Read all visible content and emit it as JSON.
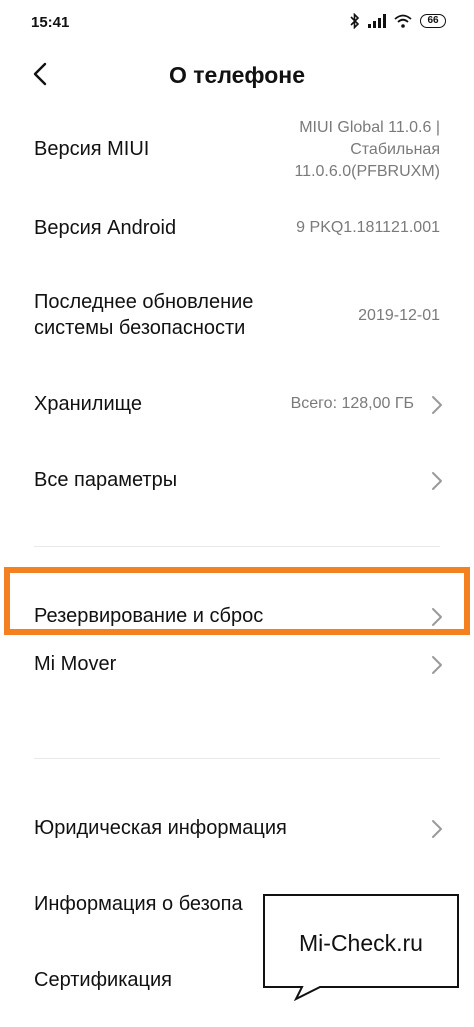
{
  "status_bar": {
    "time": "15:41",
    "battery": "66",
    "icons": [
      "bluetooth-icon",
      "signal-icon",
      "wifi-icon",
      "battery-icon"
    ]
  },
  "header": {
    "title": "О телефоне",
    "back_icon": "chevron-left-icon"
  },
  "rows": {
    "miui": {
      "label": "Версия MIUI",
      "value_lines": [
        "MIUI Global 11.0.6 |",
        "Стабильная",
        "11.0.6.0(PFBRUXM)"
      ]
    },
    "android": {
      "label": "Версия Android",
      "value": "9 PKQ1.181121.001"
    },
    "security": {
      "label_lines": [
        "Последнее обновление",
        "системы безопасности"
      ],
      "value": "2019-12-01"
    },
    "storage": {
      "label": "Хранилище",
      "value": "Всего: 128,00 ГБ"
    },
    "all_params": {
      "label": "Все параметры"
    },
    "backup": {
      "label": "Резервирование и сброс"
    },
    "mi_mover": {
      "label": "Mi Mover"
    },
    "legal": {
      "label": "Юридическая информация"
    },
    "security_info": {
      "label": "Информация о безопа"
    },
    "certification": {
      "label": "Сертификация"
    }
  },
  "highlight_color": "#f5801f",
  "watermark": {
    "text": "Mi-Check.ru"
  }
}
